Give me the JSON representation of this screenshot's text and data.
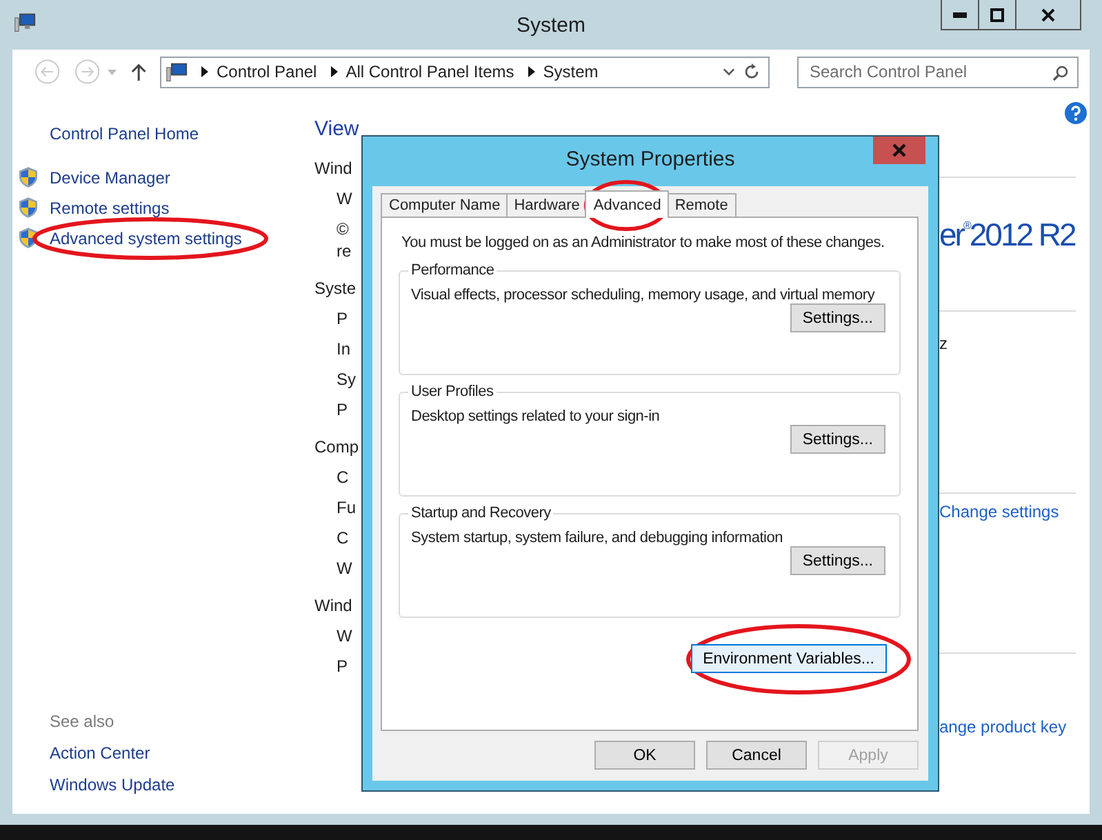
{
  "window": {
    "title": "System"
  },
  "address_bar": {
    "crumbs": [
      "Control Panel",
      "All Control Panel Items",
      "System"
    ]
  },
  "search": {
    "placeholder": "Search Control Panel"
  },
  "sidebar": {
    "home": "Control Panel Home",
    "items": [
      {
        "label": "Device Manager",
        "circled": false
      },
      {
        "label": "Remote settings",
        "circled": false
      },
      {
        "label": "Advanced system settings",
        "circled": true
      }
    ],
    "see_also_title": "See also",
    "see_also": [
      "Action Center",
      "Windows Update"
    ]
  },
  "main": {
    "heading": "View",
    "fragments": [
      {
        "kind": "heading",
        "text": "Wind"
      },
      {
        "kind": "item",
        "text": "W"
      },
      {
        "kind": "item",
        "text": "©"
      },
      {
        "kind": "tight",
        "text": "re"
      },
      {
        "kind": "heading",
        "text": "Syste"
      },
      {
        "kind": "item",
        "text": "P"
      },
      {
        "kind": "item",
        "text": "In"
      },
      {
        "kind": "item",
        "text": "Sy"
      },
      {
        "kind": "item",
        "text": "P"
      },
      {
        "kind": "heading",
        "text": "Comp"
      },
      {
        "kind": "item",
        "text": "C"
      },
      {
        "kind": "item",
        "text": "Fu"
      },
      {
        "kind": "item",
        "text": "C"
      },
      {
        "kind": "item",
        "text": "W"
      },
      {
        "kind": "heading",
        "text": "Wind"
      },
      {
        "kind": "item",
        "text": "W"
      },
      {
        "kind": "item",
        "text": "P"
      }
    ],
    "logo": "er$^{®}$2012 R2",
    "speed_fragment": "z",
    "change_settings": "Change settings",
    "product_key": "ange product key"
  },
  "dialog": {
    "title": "System Properties",
    "tabs": [
      {
        "label": "Computer Name",
        "selected": false,
        "circled": false
      },
      {
        "label": "Hardware",
        "selected": false,
        "circled": false
      },
      {
        "label": "Advanced",
        "selected": true,
        "circled": true
      },
      {
        "label": "Remote",
        "selected": false,
        "circled": false
      }
    ],
    "notice": "You must be logged on as an Administrator to make most of these changes.",
    "groups": [
      {
        "title": "Performance",
        "description": "Visual effects, processor scheduling, memory usage, and virtual memory",
        "button": "Settings..."
      },
      {
        "title": "User Profiles",
        "description": "Desktop settings related to your sign-in",
        "button": "Settings..."
      },
      {
        "title": "Startup and Recovery",
        "description": "System startup, system failure, and debugging information",
        "button": "Settings..."
      }
    ],
    "env_button": {
      "label": "Environment Variables...",
      "circled": true
    },
    "buttons": [
      {
        "label": "OK",
        "disabled": false
      },
      {
        "label": "Cancel",
        "disabled": false
      },
      {
        "label": "Apply",
        "disabled": true
      }
    ]
  }
}
